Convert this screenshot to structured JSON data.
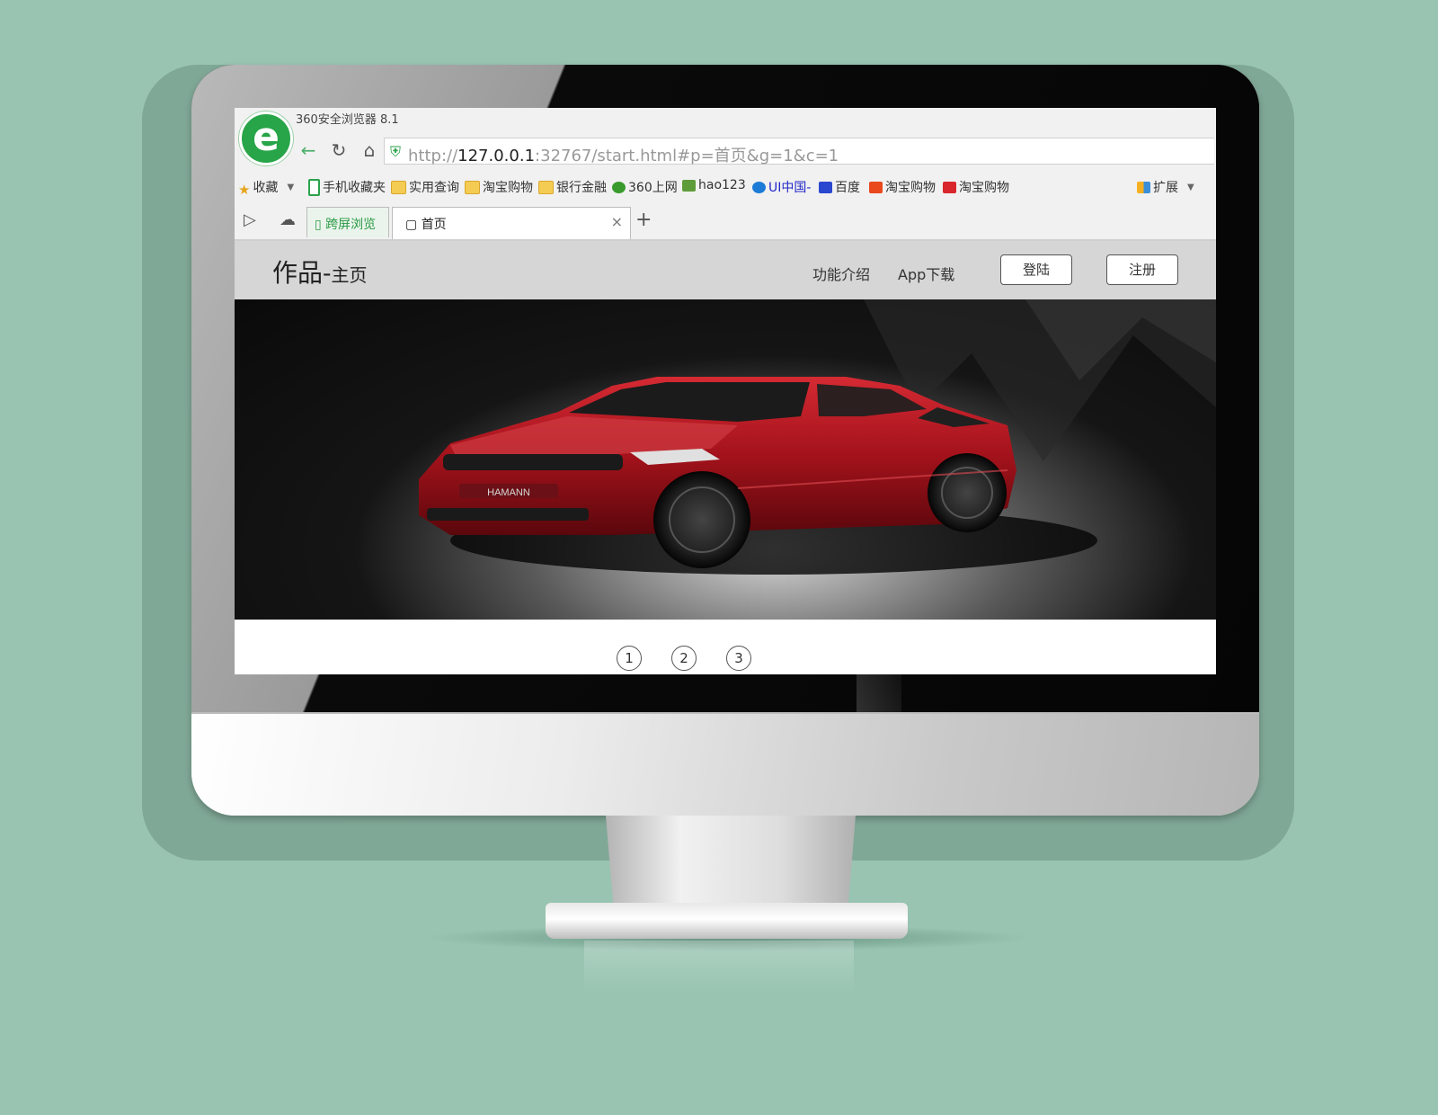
{
  "browser": {
    "window_title": "360安全浏览器 8.1",
    "url_scheme": "http://",
    "url_host": "127.0.0.1",
    "url_rest": ":32767/start.html#p=首页&g=1&c=1"
  },
  "bookmarks": [
    {
      "label": "收藏",
      "icon": "star-icon"
    },
    {
      "label": "手机收藏夹",
      "icon": "phone-icon"
    },
    {
      "label": "实用查询",
      "icon": "folder-icon"
    },
    {
      "label": "淘宝购物",
      "icon": "folder-icon"
    },
    {
      "label": "银行金融",
      "icon": "folder-icon"
    },
    {
      "label": "360上网",
      "icon": "360-icon"
    },
    {
      "label": "hao123",
      "icon": "house-icon"
    },
    {
      "label": "UI中国-",
      "icon": "ui-icon"
    },
    {
      "label": "百度",
      "icon": "baidu-paw-icon"
    },
    {
      "label": "淘宝购物",
      "icon": "taobao-icon"
    },
    {
      "label": "淘宝购物",
      "icon": "taobao-icon"
    },
    {
      "label": "扩展",
      "icon": "extension-icon"
    }
  ],
  "tabs": {
    "cross_screen": "跨屏浏览",
    "active": "首页"
  },
  "site": {
    "title_main": "作品-",
    "title_sub": "主页",
    "nav": [
      "功能介绍",
      "App下载"
    ],
    "login": "登陆",
    "register": "注册",
    "hero_badge": "HAMANN",
    "pages": [
      "1",
      "2",
      "3"
    ]
  },
  "colors": {
    "background": "#98c4b1",
    "brand_green": "#27a548",
    "header_gray": "#d6d6d6",
    "car_red": "#a3121b"
  }
}
